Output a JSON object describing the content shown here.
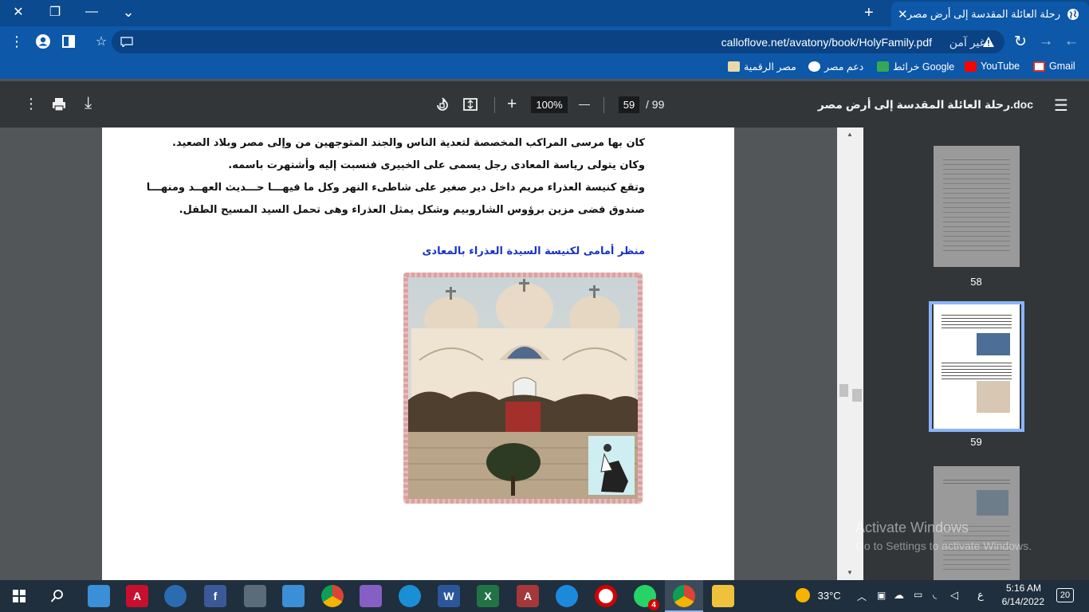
{
  "window": {
    "minimize_glyph": "—",
    "restore_glyph": "❐",
    "close_glyph": "✕",
    "tabsearch_glyph": "⌄"
  },
  "tab": {
    "title": "رحلة العائلة المقدسة إلى أرض مصر",
    "close_glyph": "✕",
    "new_tab_glyph": "+"
  },
  "address": {
    "url": "calloflove.net/avatony/book/HolyFamily.pdf",
    "security_label": "غير آمن",
    "back_glyph": "←",
    "forward_glyph": "→",
    "reload_glyph": "↻",
    "star_glyph": "☆",
    "menu_glyph": "⋮"
  },
  "bookmarks": [
    {
      "label": "Gmail",
      "color": "#d93025"
    },
    {
      "label": "YouTube",
      "color": "#ff0000"
    },
    {
      "label": "خرائط Google",
      "color": "#34a853"
    },
    {
      "label": "دعم مصر",
      "color": "#ffffff"
    },
    {
      "label": "مصر الرقمية",
      "color": "#e8d9a8"
    }
  ],
  "pdf_toolbar": {
    "doc_title": "رحلة العائلة المقدسة إلى أرض مصر.doc",
    "menu_glyph": "☰",
    "current_page": "59",
    "total_pages": "/ 99",
    "zoom": "100%",
    "zoom_out_glyph": "—",
    "zoom_in_glyph": "+",
    "download_glyph": "⤓",
    "print_glyph": "⎙",
    "more_glyph": "⋮"
  },
  "page_content": {
    "line1": "كان بها مرسى المراكب المخصصة لتعدية الناس والجند المتوجهين من وإلى مصر وبلاد الصعيد.",
    "line2": "وكان يتولى رياسة المعادى رجل يسمى على الخبيرى فنسبت إليه وأشتهرت باسمه.",
    "line3": "وتقع كنيسة العذراء مريم داخل دير صغير على شاطىء النهر وكل ما فيهـــا حـــديث العهــد ومنهـــا",
    "line4": "صندوق فضى مزين برؤوس الشاروبيم وشكل يمثل العذراء وهى تحمل السيد المسيح الطفل.",
    "caption": "منظر أمامى لكنيسة السيدة العذراء بالمعادى"
  },
  "thumbnails": [
    {
      "number": "58"
    },
    {
      "number": "59"
    }
  ],
  "watermark": {
    "line1": "Activate Windows",
    "line2": "Go to Settings to activate Windows."
  },
  "taskbar": {
    "temperature": "33°C",
    "time": "5:16 AM",
    "date": "6/14/2022",
    "notifications": "20",
    "lang": "ع",
    "whatsapp_badge": "4"
  }
}
